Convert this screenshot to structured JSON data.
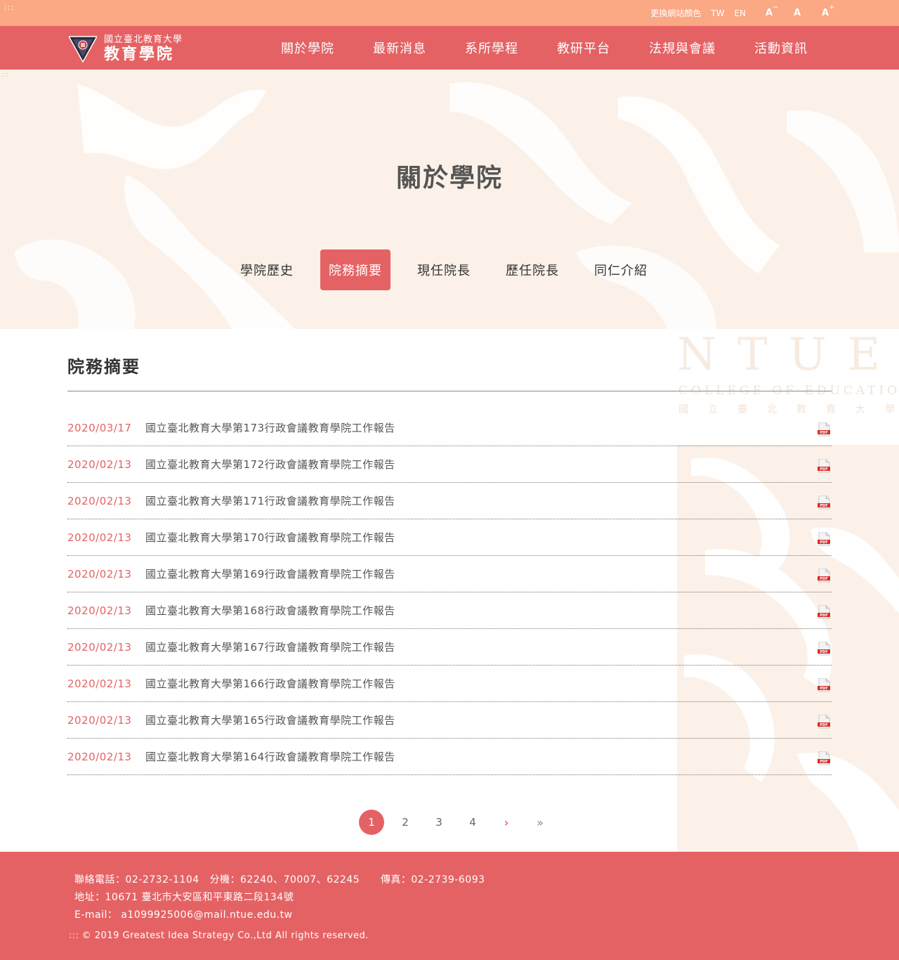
{
  "topbar": {
    "skip_marker": ":::",
    "change_color": "更換網站顏色",
    "lang_tw": "TW",
    "lang_en": "EN",
    "font_small": "A",
    "font_small_sup": "−",
    "font_normal": "A",
    "font_large": "A",
    "font_large_sup": "+"
  },
  "logo": {
    "line1": "國立臺北教育大學",
    "line2": "教育學院"
  },
  "nav": {
    "items": [
      "關於學院",
      "最新消息",
      "系所學程",
      "教研平台",
      "法規與會議",
      "活動資訊"
    ]
  },
  "hero": {
    "skip_marker": ":::",
    "title": "關於學院"
  },
  "subnav": {
    "items": [
      "學院歷史",
      "院務摘要",
      "現任院長",
      "歷任院長",
      "同仁介紹"
    ],
    "active_index": 1
  },
  "decoration": {
    "ntue": "NTUE",
    "college": "COLLEGE OF EDUCATION",
    "zh": "國立臺北教育大學"
  },
  "content": {
    "section_title": "院務摘要",
    "rows": [
      {
        "date": "2020/03/17",
        "title": "國立臺北教育大學第173行政會議教育學院工作報告",
        "icon": "pdf-icon"
      },
      {
        "date": "2020/02/13",
        "title": "國立臺北教育大學第172行政會議教育學院工作報告",
        "icon": "pdf-icon"
      },
      {
        "date": "2020/02/13",
        "title": "國立臺北教育大學第171行政會議教育學院工作報告",
        "icon": "pdf-icon"
      },
      {
        "date": "2020/02/13",
        "title": "國立臺北教育大學第170行政會議教育學院工作報告",
        "icon": "pdf-icon"
      },
      {
        "date": "2020/02/13",
        "title": "國立臺北教育大學第169行政會議教育學院工作報告",
        "icon": "pdf-icon"
      },
      {
        "date": "2020/02/13",
        "title": "國立臺北教育大學第168行政會議教育學院工作報告",
        "icon": "pdf-icon"
      },
      {
        "date": "2020/02/13",
        "title": "國立臺北教育大學第167行政會議教育學院工作報告",
        "icon": "pdf-icon"
      },
      {
        "date": "2020/02/13",
        "title": "國立臺北教育大學第166行政會議教育學院工作報告",
        "icon": "pdf-icon"
      },
      {
        "date": "2020/02/13",
        "title": "國立臺北教育大學第165行政會議教育學院工作報告",
        "icon": "pdf-icon"
      },
      {
        "date": "2020/02/13",
        "title": "國立臺北教育大學第164行政會議教育學院工作報告",
        "icon": "pdf-icon"
      }
    ]
  },
  "pagination": {
    "pages": [
      "1",
      "2",
      "3",
      "4"
    ],
    "current": "1",
    "next": "›",
    "last": "»"
  },
  "footer": {
    "phone": "聯絡電話：02-2732-1104   分機：62240、70007、62245      傳真：02-2739-6093",
    "address": "地址：10671 臺北市大安區和平東路二段134號",
    "email": "E-mail： a1099925006@mail.ntue.edu.tw",
    "copyright_marker": ":::",
    "copyright": "© 2019 Greatest Idea Strategy Co.,Ltd All rights reserved."
  },
  "colors": {
    "topbar": "#fba884",
    "accent": "#e56264",
    "hero_bg": "#fbf1e8"
  }
}
